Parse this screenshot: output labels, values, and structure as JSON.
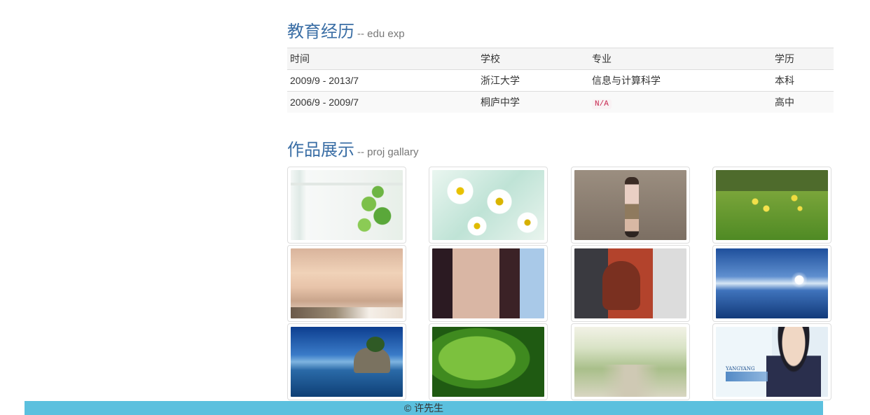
{
  "education": {
    "title": "教育经历",
    "subtitle": "-- edu exp",
    "headers": [
      "时间",
      "学校",
      "专业",
      "学历"
    ],
    "rows": [
      [
        "2009/9 - 2013/7",
        "浙江大学",
        "信息与计算科学",
        "本科"
      ],
      [
        "2006/9 - 2009/7",
        "桐庐中学",
        "N/A",
        "高中"
      ]
    ]
  },
  "gallery": {
    "title": "作品展示",
    "subtitle": "-- proj gallary",
    "items": [
      {
        "name": "plant-window"
      },
      {
        "name": "daisies"
      },
      {
        "name": "girl-standing"
      },
      {
        "name": "yellow-flowers-meadow"
      },
      {
        "name": "mountains-clouds"
      },
      {
        "name": "girl-portrait"
      },
      {
        "name": "girl-red-sweater"
      },
      {
        "name": "sea-reflection"
      },
      {
        "name": "island"
      },
      {
        "name": "green-leaves"
      },
      {
        "name": "tree-lined-road"
      },
      {
        "name": "man-portrait",
        "caption": "YANGYANG"
      }
    ]
  },
  "footer": {
    "text": "© 许先生"
  }
}
